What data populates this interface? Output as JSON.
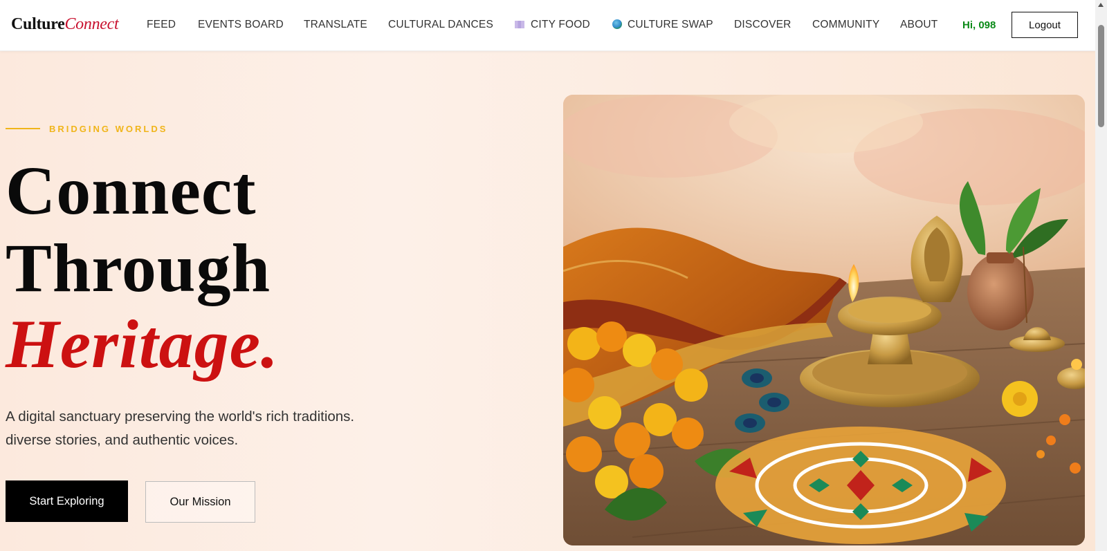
{
  "brand": {
    "part1": "Culture",
    "part2": "Connect"
  },
  "nav": {
    "items": [
      {
        "label": "FEED"
      },
      {
        "label": "EVENTS BOARD"
      },
      {
        "label": "TRANSLATE"
      },
      {
        "label": "CULTURAL DANCES"
      },
      {
        "label": "CITY FOOD",
        "icon": "map-icon"
      },
      {
        "label": "CULTURE SWAP",
        "icon": "globe-icon"
      },
      {
        "label": "DISCOVER"
      },
      {
        "label": "COMMUNITY"
      },
      {
        "label": "ABOUT"
      }
    ],
    "greeting": "Hi, 098",
    "logout_label": "Logout"
  },
  "hero": {
    "eyebrow": "BRIDGING WORLDS",
    "title_line1": "Connect",
    "title_line2": "Through",
    "title_line3": "Heritage.",
    "description_line1": "A digital sanctuary preserving the world's rich traditions.",
    "description_line2": "diverse stories, and authentic voices.",
    "primary_button": "Start Exploring",
    "secondary_button": "Our Mission"
  },
  "colors": {
    "accent_red": "#cc1111",
    "accent_gold": "#f0b51a",
    "greeting_green": "#0a8a17",
    "background": "#fdf0e8"
  }
}
